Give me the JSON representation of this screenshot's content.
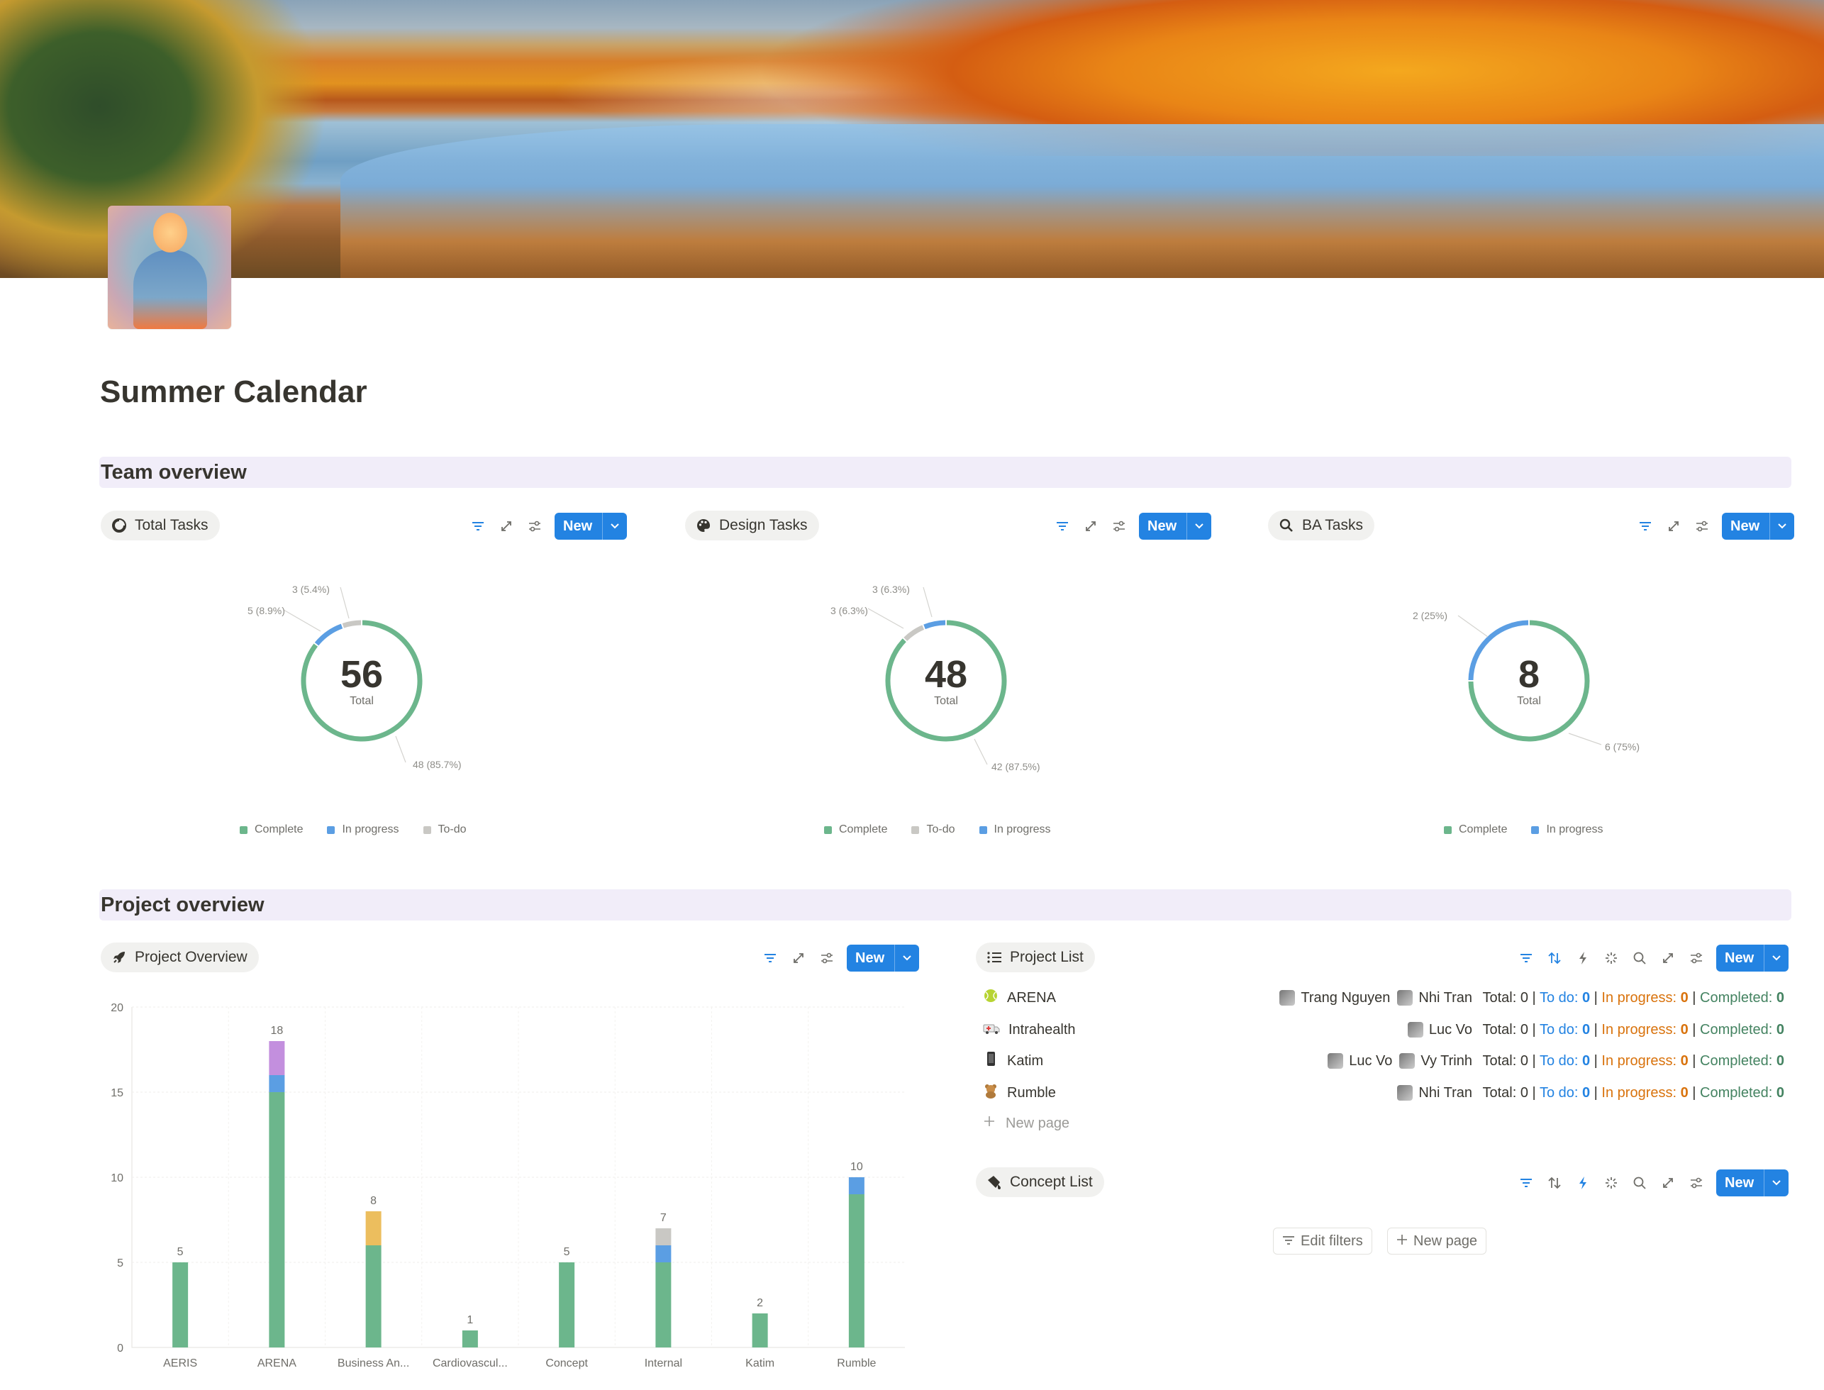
{
  "page": {
    "title": "Summer Calendar"
  },
  "sections": {
    "team": "Team overview",
    "project": "Project overview"
  },
  "new_label": "New",
  "widgets": {
    "total": {
      "title": "Total Tasks",
      "icon": "pie-chart-icon"
    },
    "design": {
      "title": "Design Tasks",
      "icon": "palette-icon"
    },
    "ba": {
      "title": "BA Tasks",
      "icon": "magnifier-icon"
    },
    "project_overview": {
      "title": "Project Overview",
      "icon": "rocket-icon"
    },
    "project_list": {
      "title": "Project List",
      "icon": "list-icon"
    },
    "concept_list": {
      "title": "Concept List",
      "icon": "paint-brush-icon"
    }
  },
  "colors": {
    "complete": "#6cb68c",
    "in_progress": "#5b9ee3",
    "todo": "#c9c8c4",
    "extra_purple": "#c38fde",
    "extra_yellow": "#ecbe5e",
    "accent": "#2383e2"
  },
  "chart_data": [
    {
      "type": "pie",
      "chart": "donut",
      "center_value": "56",
      "center_label": "Total",
      "slices": [
        {
          "name": "Complete",
          "value": 48,
          "label": "48 (85.7%)"
        },
        {
          "name": "In progress",
          "value": 5,
          "label": "5 (8.9%)"
        },
        {
          "name": "To-do",
          "value": 3,
          "label": "3 (5.4%)"
        }
      ],
      "legend": [
        "Complete",
        "In progress",
        "To-do"
      ]
    },
    {
      "type": "pie",
      "chart": "donut",
      "center_value": "48",
      "center_label": "Total",
      "slices": [
        {
          "name": "Complete",
          "value": 42,
          "label": "42 (87.5%)"
        },
        {
          "name": "To-do",
          "value": 3,
          "label": "3 (6.3%)"
        },
        {
          "name": "In progress",
          "value": 3,
          "label": "3 (6.3%)"
        }
      ],
      "legend": [
        "Complete",
        "To-do",
        "In progress"
      ]
    },
    {
      "type": "pie",
      "chart": "donut",
      "center_value": "8",
      "center_label": "Total",
      "slices": [
        {
          "name": "Complete",
          "value": 6,
          "label": "6 (75%)"
        },
        {
          "name": "In progress",
          "value": 2,
          "label": "2 (25%)"
        }
      ],
      "legend": [
        "Complete",
        "In progress"
      ]
    },
    {
      "type": "bar",
      "stacked": true,
      "categories": [
        "AERIS",
        "ARENA",
        "Business An...",
        "Cardiovascul...",
        "Concept",
        "Internal",
        "Katim",
        "Rumble"
      ],
      "series": [
        {
          "values": [
            5,
            15,
            6,
            1,
            5,
            5,
            2,
            9
          ],
          "color": "#6cb68c"
        },
        {
          "values": [
            0,
            1,
            0,
            0,
            0,
            1,
            0,
            1
          ],
          "color": "#5b9ee3"
        },
        {
          "values": [
            0,
            0,
            0,
            0,
            0,
            1,
            0,
            0
          ],
          "color": "#c9c8c4"
        },
        {
          "values": [
            0,
            2,
            0,
            0,
            0,
            0,
            0,
            0
          ],
          "color": "#c38fde"
        },
        {
          "values": [
            0,
            0,
            2,
            0,
            0,
            0,
            0,
            0
          ],
          "color": "#ecbe5e"
        }
      ],
      "totals": [
        "5",
        "18",
        "8",
        "1",
        "5",
        "7",
        "2",
        "10"
      ],
      "yticks": [
        "0",
        "5",
        "10",
        "15",
        "20"
      ],
      "ylim": [
        0,
        20
      ],
      "grid": true
    }
  ],
  "project_list": {
    "rows": [
      {
        "name": "ARENA",
        "icon": "tennis-ball-icon",
        "people": [
          "Trang Nguyen",
          "Nhi Tran"
        ]
      },
      {
        "name": "Intrahealth",
        "icon": "ambulance-icon",
        "people": [
          "Luc Vo"
        ]
      },
      {
        "name": "Katim",
        "icon": "mobile-phone-icon",
        "people": [
          "Luc Vo",
          "Vy Trinh"
        ]
      },
      {
        "name": "Rumble",
        "icon": "teddy-bear-icon",
        "people": [
          "Nhi Tran"
        ]
      }
    ],
    "stats": {
      "total": "Total: 0",
      "sep": " | ",
      "todo_label": "To do: ",
      "todo": "0",
      "prog_label": "In progress: ",
      "prog": "0",
      "done_label": "Completed: ",
      "done": "0"
    },
    "new_page": "New page"
  },
  "concept_list": {
    "edit_filters": "Edit filters",
    "new_page": "New page"
  }
}
